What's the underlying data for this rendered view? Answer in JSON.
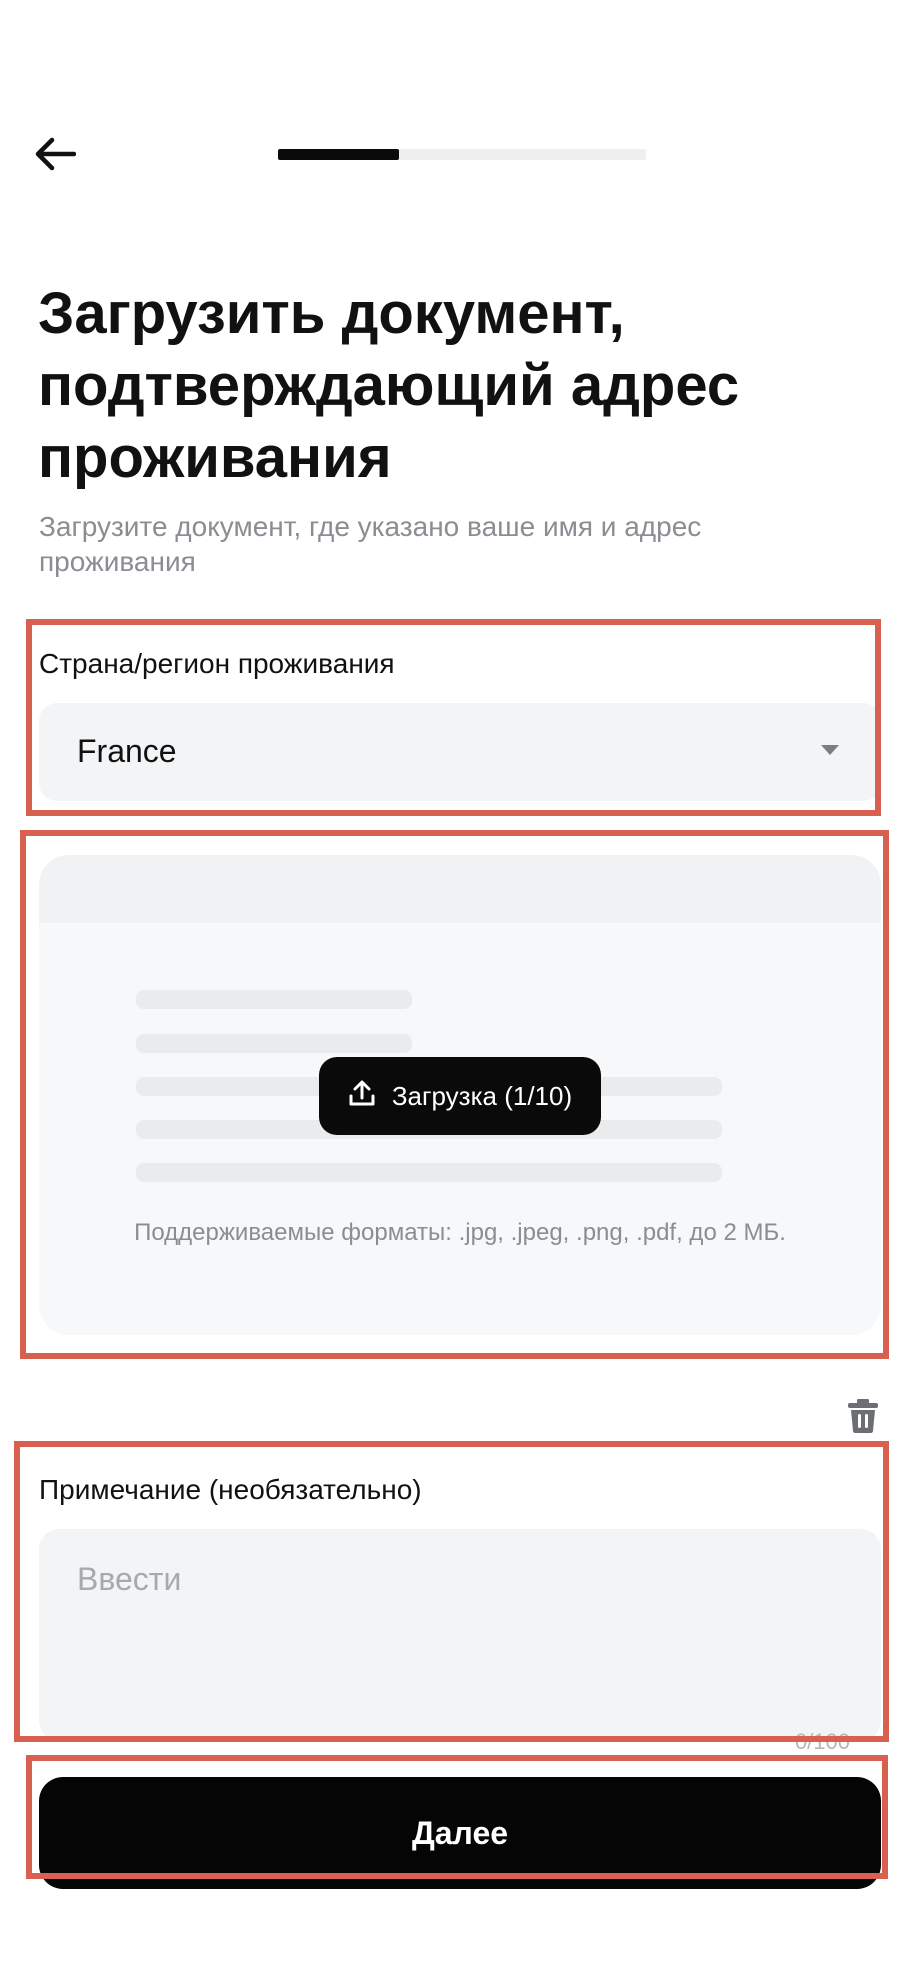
{
  "header": {
    "back_icon": "arrow-left-icon",
    "progress": {
      "fraction": 0.33
    }
  },
  "main": {
    "title": "Загрузить документ, подтверждающий адрес проживания",
    "subtitle": "Загрузите документ, где указано ваше имя и адрес проживания"
  },
  "country": {
    "label": "Страна/регион проживания",
    "selected": "France",
    "caret_icon": "caret-down-icon"
  },
  "upload": {
    "button_label": "Загрузка (1/10)",
    "button_icon": "upload-icon",
    "formats_text": "Поддерживаемые форматы: .jpg, .jpeg, .png, .pdf, до 2 МБ.",
    "delete_icon": "trash-icon"
  },
  "note": {
    "label": "Примечание (необязательно)",
    "placeholder": "Ввести",
    "counter": "0/100"
  },
  "footer": {
    "next_label": "Далее"
  },
  "colors": {
    "highlight": "#d9604f",
    "primary": "#0a0a0a",
    "field_bg": "#f3f4f5"
  }
}
